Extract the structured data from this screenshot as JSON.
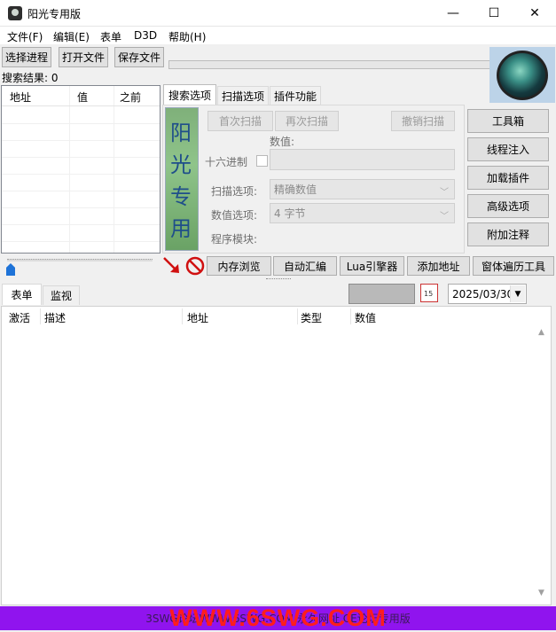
{
  "window": {
    "title": "阳光专用版",
    "minimize": "—",
    "maximize": "☐",
    "close": "✕"
  },
  "menu": [
    "文件(F)",
    "编辑(E)",
    "表单",
    "D3D",
    "帮助(H)"
  ],
  "toolbar": {
    "select_process": "选择进程",
    "open_file": "打开文件",
    "save_file": "保存文件"
  },
  "results": {
    "label": "搜索结果: 0",
    "columns": [
      "地址",
      "值",
      "之前"
    ]
  },
  "tabs": [
    "搜索选项",
    "扫描选项",
    "插件功能"
  ],
  "sun_chars": [
    "阳",
    "光",
    "专",
    "用"
  ],
  "scan": {
    "first_scan": "首次扫描",
    "next_scan": "再次扫描",
    "undo_scan": "撤销扫描",
    "value_label": "数值:",
    "hex_label": "十六进制",
    "scan_type_label": "扫描选项:",
    "scan_type_value": "精确数值",
    "value_type_label": "数值选项:",
    "value_type_value": "4 字节",
    "module_label": "程序模块:"
  },
  "right_buttons": [
    "工具箱",
    "线程注入",
    "加载插件",
    "高级选项",
    "附加注释"
  ],
  "bottom_buttons": [
    "内存浏览",
    "自动汇编",
    "Lua引擎器",
    "添加地址",
    "窗体遍历工具"
  ],
  "lower_tabs": [
    "表单",
    "监视"
  ],
  "calendar_day": "15",
  "date": "2025/03/30",
  "table_headers": [
    "激活",
    "描述",
    "地址",
    "类型",
    "数值"
  ],
  "footer": {
    "text": "3SWG论坛WWW.6SWG.COM 永久网址 CE论坛专用版",
    "overlay": "WWW.6SWG.COM"
  },
  "colors": {
    "footer_bg": "#9014ee",
    "footer_overlay": "#ff1d1d",
    "sun_panel": "#8fc48a"
  }
}
